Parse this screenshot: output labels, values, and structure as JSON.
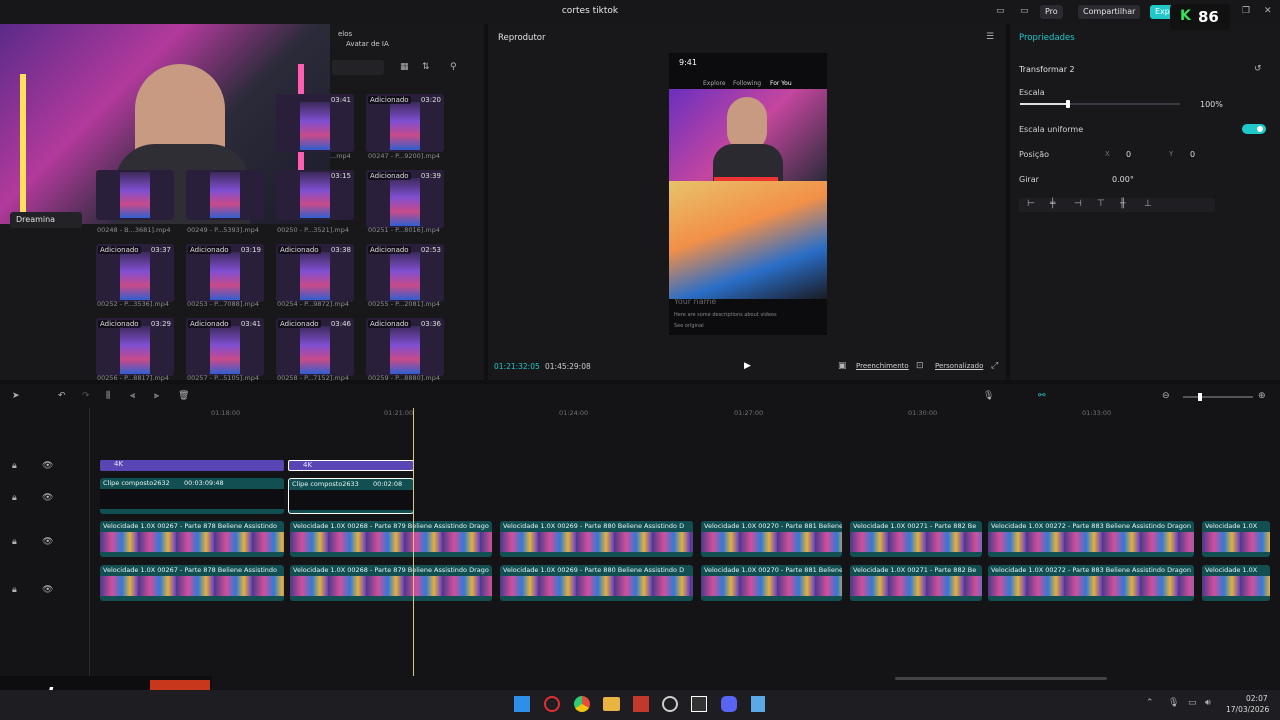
{
  "app": {
    "title": "cortes tiktok",
    "pro": "Pro",
    "share": "Compartilhar",
    "export": "Exportar"
  },
  "overlay": {
    "stream_number": "86",
    "watermark": "vody.gg"
  },
  "media": {
    "tabs": [
      "elos",
      "Avatar de IA"
    ],
    "sidebar": {
      "item": "Dreamina"
    },
    "items": [
      {
        "tag": "Adicionado",
        "dur": "03:41",
        "name": "...mp4"
      },
      {
        "tag": "Adicionado",
        "dur": "03:20",
        "name": "00247 - P...9200].mp4"
      },
      {
        "tag": "",
        "dur": "03:15",
        "name": ""
      },
      {
        "tag": "Adicionado",
        "dur": "03:39",
        "name": "00251 - P...8016].mp4"
      },
      {
        "tag": "",
        "dur": "",
        "name": "00248 - B...3681].mp4"
      },
      {
        "tag": "",
        "dur": "",
        "name": "00249 - P...5393].mp4"
      },
      {
        "tag": "",
        "dur": "",
        "name": "00250 - P...3521].mp4"
      },
      {
        "tag": "Adicionado",
        "dur": "03:37",
        "name": "00252 - P...3536].mp4"
      },
      {
        "tag": "Adicionado",
        "dur": "03:19",
        "name": "00253 - P...7088].mp4"
      },
      {
        "tag": "Adicionado",
        "dur": "03:38",
        "name": "00254 - P...9872].mp4"
      },
      {
        "tag": "Adicionado",
        "dur": "02:53",
        "name": "00255 - P...2081].mp4"
      },
      {
        "tag": "Adicionado",
        "dur": "03:29",
        "name": "00256 - P...8817].mp4"
      },
      {
        "tag": "Adicionado",
        "dur": "03:41",
        "name": "00257 - P...5105].mp4"
      },
      {
        "tag": "Adicionado",
        "dur": "03:46",
        "name": "00258 - P...7152].mp4"
      },
      {
        "tag": "Adicionado",
        "dur": "03:36",
        "name": "00259 - P...8880].mp4"
      }
    ]
  },
  "player": {
    "title": "Reprodutor",
    "time_current": "01:21:32:05",
    "time_total": "01:45:29:08",
    "fill_label": "Preenchimento",
    "custom_label": "Personalizado",
    "phone": {
      "clock": "9:41",
      "tab1": "Explore",
      "tab2": "Following",
      "tab3": "For You",
      "username": "Your name",
      "description": "Here are some descriptions about videos",
      "see_original": "See original"
    }
  },
  "props": {
    "title": "Propriedades",
    "section": "Transformar 2",
    "scale_label": "Escala",
    "scale_value": "100%",
    "scale_fraction": 0.3,
    "uniform_label": "Escala uniforme",
    "position_label": "Posição",
    "pos_x_label": "X",
    "pos_x": "0",
    "pos_y_label": "Y",
    "pos_y": "0",
    "rotate_label": "Girar",
    "rotate_value": "0.00°"
  },
  "timeline": {
    "ruler": [
      "01:18:00",
      "01:21:00",
      "01:24:00",
      "01:27:00",
      "01:30:00",
      "01:33:00"
    ],
    "tag_4k": "4K",
    "compound1": {
      "name": "Clipe composto2632",
      "dur": "00:03:09:48"
    },
    "compound2": {
      "name": "Clipe composto2633",
      "dur": "00:02:08"
    },
    "clips": [
      "Velocidade 1.0X  00267 - Parte 878 Beliene Assistindo",
      "Velocidade 1.0X  00268 - Parte 879 Beliene Assistindo Drago",
      "Velocidade 1.0X  00269 - Parte 880 Beliene Assistindo D",
      "Velocidade 1.0X  00270 - Parte 881 Beliene",
      "Velocidade 1.0X  00271 - Parte 882 Be",
      "Velocidade 1.0X  00272 - Parte 883 Beliene Assistindo Dragon",
      "Velocidade 1.0X"
    ]
  },
  "taskbar": {
    "time": "02:07",
    "date": "17/03/2026"
  }
}
